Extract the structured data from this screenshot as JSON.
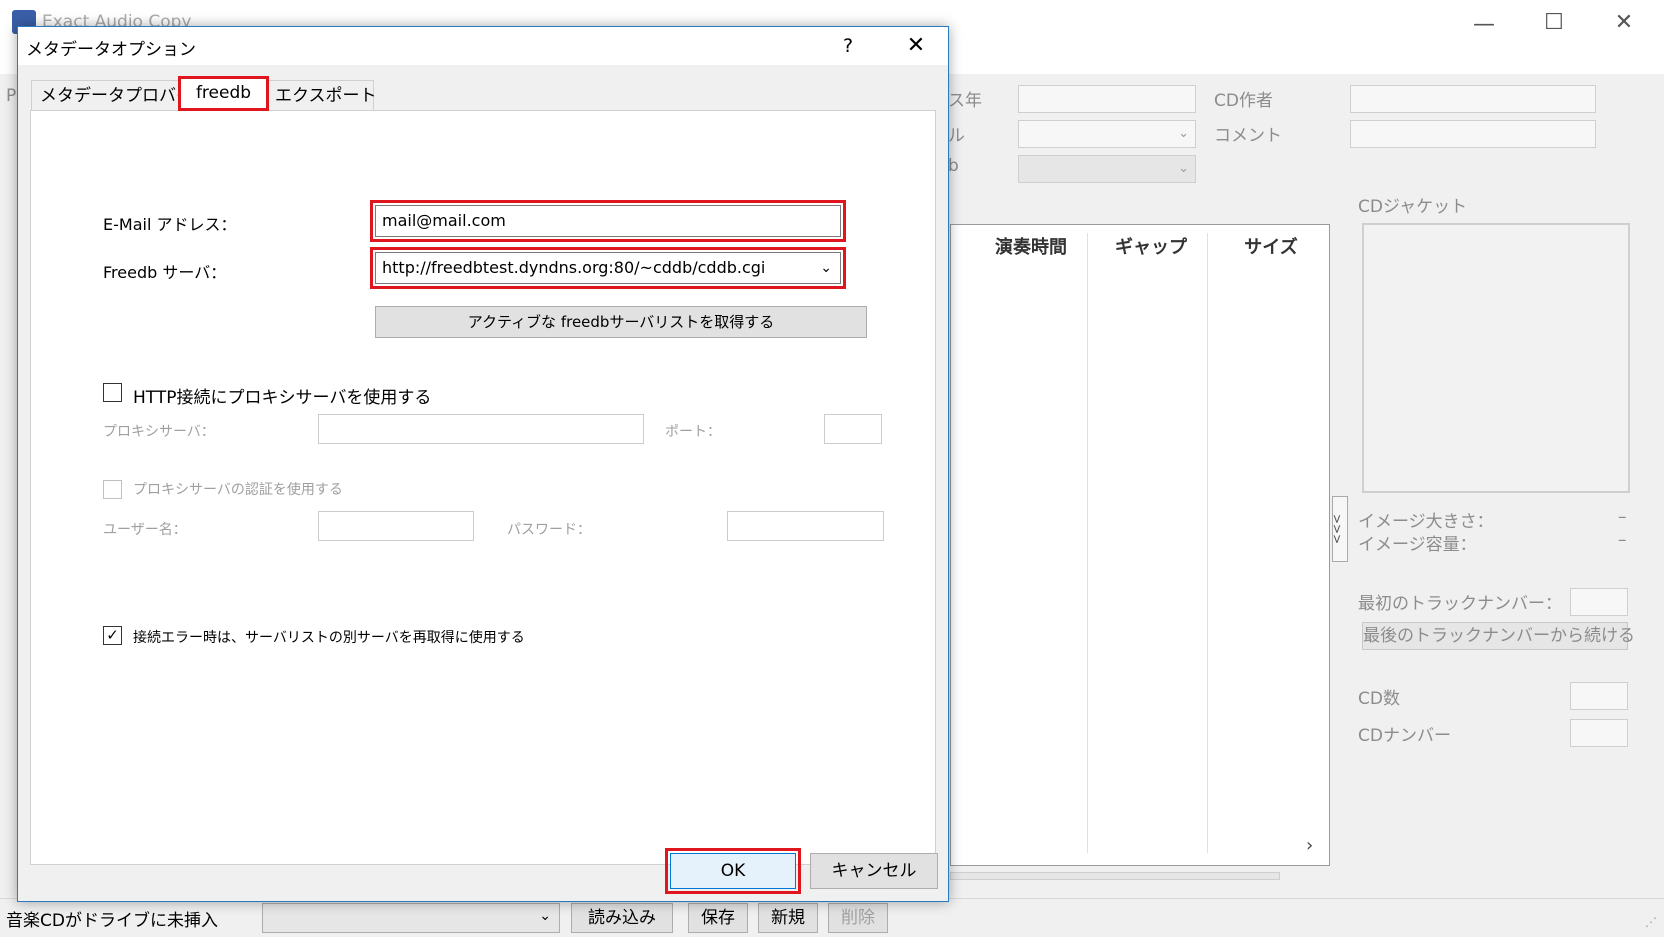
{
  "background_window": {
    "title": "Exact Audio Copy",
    "controls": {
      "minimize": "—",
      "maximize": "☐",
      "close": "✕"
    },
    "fields": {
      "release_year": "ス年",
      "cd_author": "CD作者",
      "genre_fragment": "ル",
      "comment": "コメント",
      "db_fragment": "b"
    },
    "track_columns": [
      "演奏時間",
      "ギャップ",
      "サイズ"
    ],
    "jacket": {
      "label": "CDジャケット",
      "image_size_label": "イメージ大きさ：",
      "image_size_value": "–",
      "image_capacity_label": "イメージ容量：",
      "image_capacity_value": "–",
      "expand_glyph": ">>>",
      "first_track_label": "最初のトラックナンバー：",
      "continue_button": "最後のトラックナンバーから続ける",
      "cd_count_label": "CD数",
      "cd_number_label": "CDナンバー"
    },
    "status_bar": {
      "status_text": "音楽CDがドライブに未挿入",
      "buttons": {
        "load": "読み込み",
        "save": "保存",
        "new": "新規",
        "delete": "削除"
      }
    },
    "side_fragment": "P"
  },
  "dialog": {
    "title": "メタデータオプション",
    "help": "?",
    "close": "✕",
    "tabs": [
      {
        "label": "メタデータプロバイダ",
        "active": false
      },
      {
        "label": "freedb",
        "active": true
      },
      {
        "label": "エクスポート",
        "active": false
      }
    ],
    "email": {
      "label": "E-Mail アドレス：",
      "value": "mail@mail.com"
    },
    "server": {
      "label": "Freedb サーバ：",
      "value": "http://freedbtest.dyndns.org:80/~cddb/cddb.cgi"
    },
    "get_servers_button": "アクティブな freedbサーバリストを取得する",
    "use_proxy": {
      "label": "HTTP接続にプロキシサーバを使用する",
      "checked": false
    },
    "proxy_server": {
      "label": "プロキシサーバ：",
      "value": ""
    },
    "port": {
      "label": "ポート：",
      "value": ""
    },
    "use_proxy_auth": {
      "label": "プロキシサーバの認証を使用する",
      "checked": false
    },
    "username": {
      "label": "ユーザー名：",
      "value": ""
    },
    "password": {
      "label": "パスワード：",
      "value": ""
    },
    "retry_on_error": {
      "label": "接続エラー時は、サーバリストの別サーバを再取得に使用する",
      "checked": true,
      "mark": "✓"
    },
    "ok_button": "OK",
    "cancel_button": "キャンセル"
  },
  "colors": {
    "highlight": "#e0161e",
    "accent": "#0078d7"
  }
}
